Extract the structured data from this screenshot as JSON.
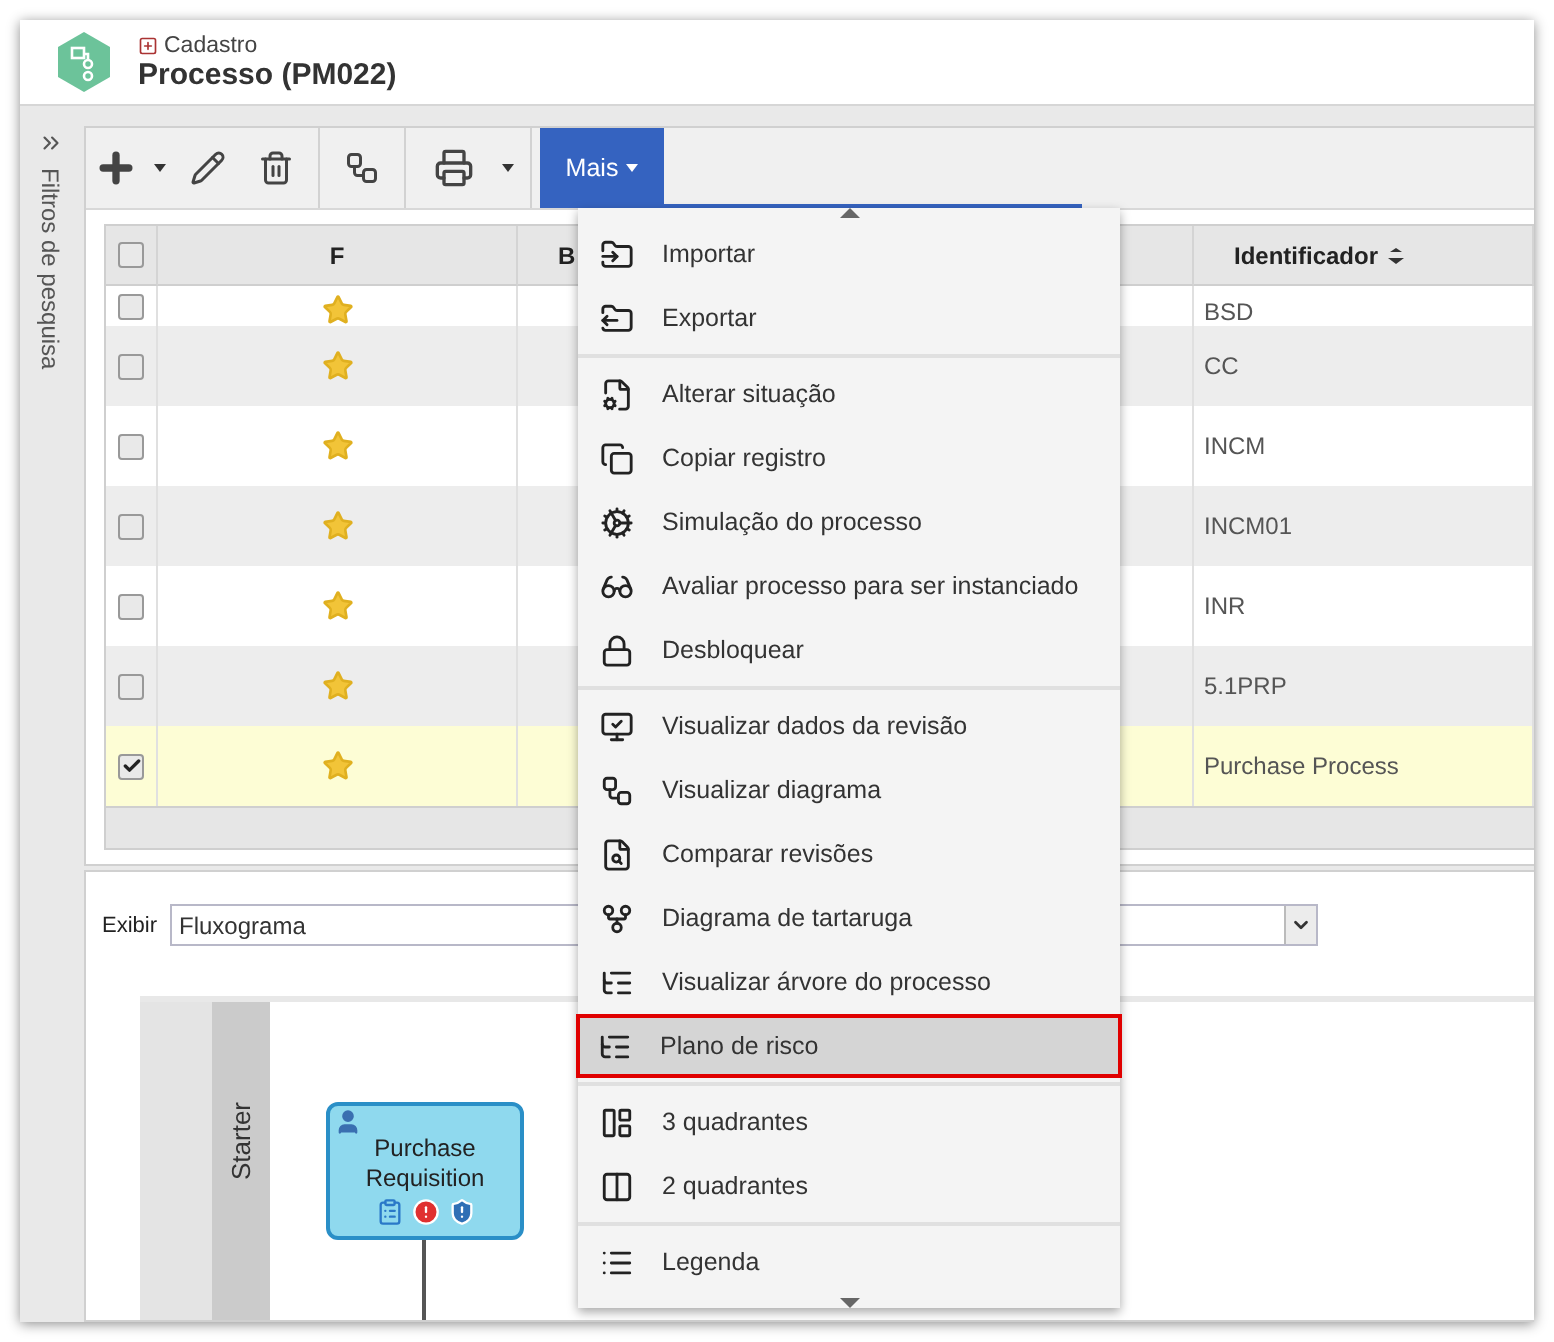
{
  "header": {
    "category": "Cadastro",
    "title": "Processo (PM022)"
  },
  "sidebar": {
    "label": "Filtros de pesquisa"
  },
  "toolbar": {
    "more_button": {
      "label": "Mais",
      "selected": true
    }
  },
  "table": {
    "all_checked": false,
    "columns": [
      "F",
      "B",
      "Identificador"
    ],
    "rows": [
      {
        "identifier": "BSD",
        "checked": false,
        "selected": false,
        "partial": true
      },
      {
        "identifier": "CC",
        "checked": false,
        "selected": false
      },
      {
        "identifier": "INCM",
        "checked": false,
        "selected": false
      },
      {
        "identifier": "INCM01",
        "checked": false,
        "selected": false
      },
      {
        "identifier": "INR",
        "checked": false,
        "selected": false
      },
      {
        "identifier": "5.1PRP",
        "checked": false,
        "selected": false
      },
      {
        "identifier": "Purchase Process",
        "checked": true,
        "selected": true
      }
    ]
  },
  "menu": {
    "sections": [
      {
        "items": [
          {
            "label": "Importar",
            "selected": false
          },
          {
            "label": "Exportar",
            "selected": false
          }
        ]
      },
      {
        "items": [
          {
            "label": "Alterar situação",
            "selected": false
          },
          {
            "label": "Copiar registro",
            "selected": false
          },
          {
            "label": "Simulação do processo",
            "selected": false
          },
          {
            "label": "Avaliar processo para ser instanciado",
            "selected": false
          },
          {
            "label": "Desbloquear",
            "selected": false
          }
        ]
      },
      {
        "items": [
          {
            "label": "Visualizar dados da revisão",
            "selected": false
          },
          {
            "label": "Visualizar diagrama",
            "selected": false
          },
          {
            "label": "Comparar revisões",
            "selected": false
          },
          {
            "label": "Diagrama de tartaruga",
            "selected": false
          },
          {
            "label": "Visualizar árvore do processo",
            "selected": false
          },
          {
            "label": "Plano de risco",
            "selected": true
          }
        ]
      },
      {
        "items": [
          {
            "label": "3 quadrantes",
            "selected": false
          },
          {
            "label": "2 quadrantes",
            "selected": false
          }
        ]
      },
      {
        "items": [
          {
            "label": "Legenda",
            "selected": false
          }
        ]
      }
    ]
  },
  "view": {
    "label": "Exibir",
    "value": "Fluxograma"
  },
  "diagram": {
    "lane": "Starter",
    "node": "Purchase Requisition"
  }
}
